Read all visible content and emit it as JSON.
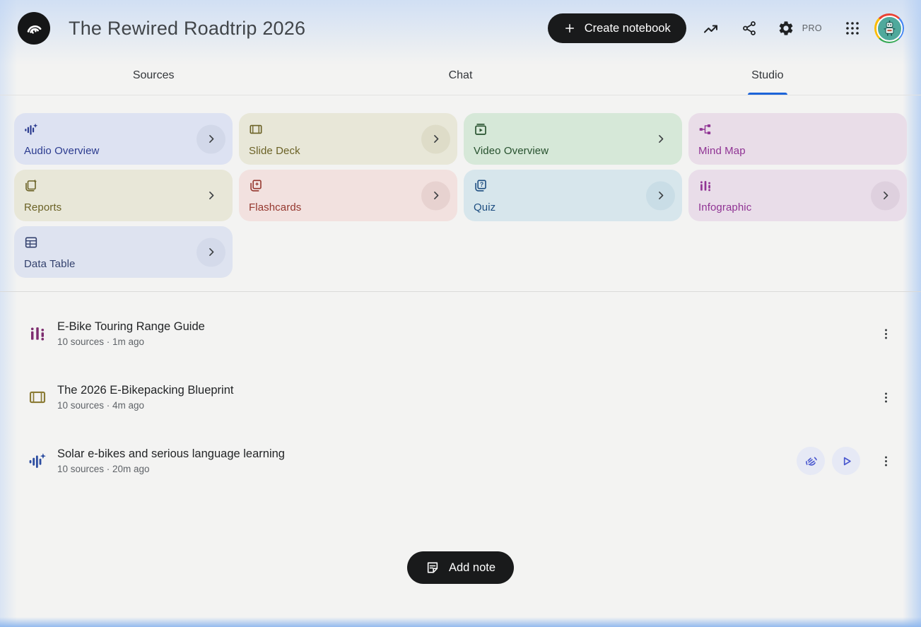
{
  "app": {
    "logo_icon": "notebooklm-logo-icon"
  },
  "header": {
    "title": "The Rewired Roadtrip 2026",
    "create_notebook": {
      "label": "Create notebook",
      "icon": "plus-icon",
      "bg": "#191a1b",
      "fg": "#ffffff"
    },
    "icons": [
      "trending-up-icon",
      "share-icon",
      "settings-gear-icon",
      "apps-grid-icon"
    ],
    "plan_badge": "PRO",
    "avatar": {
      "icon": "robot-avatar",
      "ring_colors": [
        "#ea4335",
        "#4285f4",
        "#34a853",
        "#fbbc05"
      ],
      "inner_bg": "#4fa99c"
    }
  },
  "tabs": {
    "accent_color": "#1c64d9",
    "items": [
      {
        "label": "Sources",
        "active": false
      },
      {
        "label": "Chat",
        "active": false
      },
      {
        "label": "Studio",
        "active": true
      }
    ]
  },
  "studio_tools": [
    {
      "label": "Audio Overview",
      "icon": "audio-waveform-sparkle-icon",
      "bg": "#dde2f2",
      "fg": "#2b3b8f",
      "chevron": "circle",
      "chevron_bg": "#d2d8e9"
    },
    {
      "label": "Slide Deck",
      "icon": "slide-deck-icon",
      "bg": "#e8e7d8",
      "fg": "#6b6226",
      "chevron": "circle",
      "chevron_bg": "#dedcc8"
    },
    {
      "label": "Video Overview",
      "icon": "video-overview-icon",
      "bg": "#d6e8d8",
      "fg": "#27512e",
      "chevron": "plain",
      "chevron_bg": ""
    },
    {
      "label": "Mind Map",
      "icon": "mind-map-icon",
      "bg": "#e9dde8",
      "fg": "#903494",
      "chevron": "none",
      "chevron_bg": ""
    },
    {
      "label": "Reports",
      "icon": "report-sparkle-icon",
      "bg": "#e8e7d8",
      "fg": "#6b6226",
      "chevron": "plain",
      "chevron_bg": ""
    },
    {
      "label": "Flashcards",
      "icon": "flashcards-icon",
      "bg": "#f2e1df",
      "fg": "#95372e",
      "chevron": "circle",
      "chevron_bg": "#e7d2d0"
    },
    {
      "label": "Quiz",
      "icon": "quiz-icon",
      "bg": "#d7e6ec",
      "fg": "#1d4d80",
      "chevron": "circle",
      "chevron_bg": "#c9dde6"
    },
    {
      "label": "Infographic",
      "icon": "infographic-bars-icon",
      "bg": "#e9dde9",
      "fg": "#903494",
      "chevron": "circle",
      "chevron_bg": "#ded0de"
    },
    {
      "label": "Data Table",
      "icon": "data-table-icon",
      "bg": "#dee3f0",
      "fg": "#34426e",
      "chevron": "circle",
      "chevron_bg": "#d4daea"
    }
  ],
  "artifacts": [
    {
      "title": "E-Bike Touring Range Guide",
      "meta": "10 sources · 1m ago",
      "icon": "infographic-bars-icon",
      "icon_color": "#7d2c6f",
      "actions": []
    },
    {
      "title": "The 2026 E-Bikepacking Blueprint",
      "meta": "10 sources · 4m ago",
      "icon": "slide-deck-icon",
      "icon_color": "#8b7b35",
      "actions": []
    },
    {
      "title": "Solar e-bikes and serious language learning",
      "meta": "10 sources · 20m ago",
      "icon": "audio-waveform-sparkle-icon",
      "icon_color": "#2c4da1",
      "actions": [
        {
          "icon": "interactive-mode-hand-icon",
          "bg": "#e6e9f5",
          "fg": "#4a58cf"
        },
        {
          "icon": "play-icon",
          "bg": "#e6e9f5",
          "fg": "#4a58cf"
        }
      ]
    }
  ],
  "footer": {
    "add_note": {
      "label": "Add note",
      "icon": "note-icon",
      "bg": "#191a1b",
      "fg": "#ffffff"
    }
  }
}
